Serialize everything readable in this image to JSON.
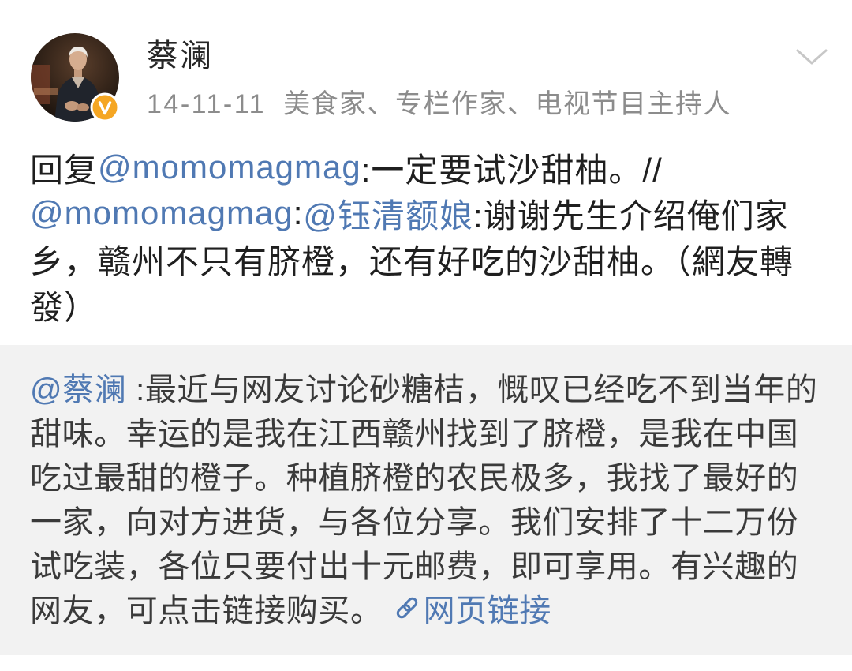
{
  "post": {
    "author": {
      "name": "蔡澜"
    },
    "meta": {
      "date": "14-11-11",
      "author_description": "美食家、专栏作家、电视节目主持人"
    },
    "body": {
      "lines": [
        [
          {
            "text": "回复",
            "mention": false
          },
          {
            "text": "@momomagmag",
            "mention": true
          },
          {
            "text": ":一定要试沙甜柚。//",
            "mention": false
          }
        ],
        [
          {
            "text": "@momomagmag",
            "mention": true
          },
          {
            "text": ":",
            "mention": false
          },
          {
            "text": "@钰清额娘",
            "mention": true
          },
          {
            "text": ":谢谢先生介绍俺们家",
            "mention": false
          }
        ],
        [
          {
            "text": "乡，赣州不只有脐橙，还有好吃的沙甜柚。（網友轉",
            "mention": false
          }
        ],
        [
          {
            "text": "發）",
            "mention": false
          }
        ]
      ]
    },
    "retweet": {
      "lines": [
        [
          {
            "text": "@蔡澜",
            "mention": true
          },
          {
            "text": " :最近与网友讨论砂糖桔，慨叹已经吃不到当年的",
            "mention": false
          }
        ],
        [
          {
            "text": "甜味。幸运的是我在江西赣州找到了脐橙，是我在中国",
            "mention": false
          }
        ],
        [
          {
            "text": "吃过最甜的橙子。种植脐橙的农民极多，我找了最好的",
            "mention": false
          }
        ],
        [
          {
            "text": "一家，向对方进货，与各位分享。我们安排了十二万份",
            "mention": false
          }
        ],
        [
          {
            "text": "试吃装，各位只要付出十元邮费，即可享用。有兴趣的",
            "mention": false
          }
        ],
        [
          {
            "text": "网友，可点击链接购买。",
            "mention": false
          }
        ]
      ],
      "link": {
        "label": "网页链接",
        "icon": "link-icon"
      }
    }
  },
  "icons": {
    "menu": "chevron-down-icon",
    "verified": "verified-badge-icon",
    "link": "link-icon"
  },
  "colors": {
    "text": "#1f1f1f",
    "meta": "#8c8c8c",
    "mention": "#5079b3",
    "quote_bg": "#f2f2f2",
    "quote_text": "#3a3a3a",
    "badge": "#f5a623"
  }
}
